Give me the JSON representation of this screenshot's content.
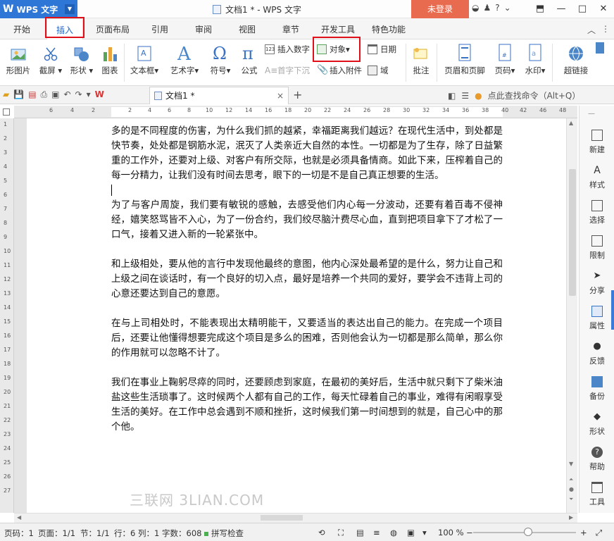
{
  "window": {
    "app_name": "WPS 文字",
    "title": "文档1 * - WPS 文字",
    "login_label": "未登录",
    "help_label": "?",
    "controls": [
      "—",
      "□",
      "✕"
    ]
  },
  "menu": {
    "tabs": [
      "开始",
      "插入",
      "页面布局",
      "引用",
      "审阅",
      "视图",
      "章节",
      "开发工具",
      "特色功能"
    ],
    "active": "插入"
  },
  "ribbon": {
    "big": [
      "形图片",
      "截屏",
      "形状",
      "图表",
      "文本框",
      "艺术字",
      "符号",
      "公式",
      "批注",
      "页眉和页脚",
      "页码",
      "水印",
      "超链接"
    ],
    "small": {
      "insert_number": "插入数字",
      "first_drop": "首字下沉",
      "object": "对象",
      "insert_attachment": "插入附件",
      "date": "日期",
      "field": "域"
    }
  },
  "doc_tab": {
    "name": "文档1 *",
    "search_hint": "点此查找命令（Alt+Q）"
  },
  "ruler": {
    "h_ticks": [
      "6",
      "4",
      "2",
      "2",
      "4",
      "6",
      "8",
      "10",
      "12",
      "14",
      "16",
      "18",
      "20",
      "22",
      "24",
      "26",
      "28",
      "30",
      "32",
      "34",
      "36",
      "38",
      "40",
      "42",
      "46",
      "48"
    ],
    "v_ticks": [
      "1",
      "2",
      "3",
      "4",
      "5",
      "6",
      "7",
      "8",
      "9",
      "10",
      "11",
      "12",
      "13",
      "14",
      "15",
      "16",
      "17",
      "18",
      "19",
      "20",
      "21",
      "22",
      "23",
      "24",
      "25",
      "26",
      "27"
    ]
  },
  "document": {
    "paragraphs": [
      "多的是不同程度的伤害，为什么我们抓的越紧，幸福距离我们越远？在现代生活中，到处都是快节奏，处处都是钢筋水泥，泯灭了人类亲近大自然的本性。一切都是为了生存，除了日益繁重的工作外，还要对上级、对客户有所交际，也就是必须具备情商。如此下来，压榨着自己的每一分精力，让我们没有时间去思考，眼下的一切是不是自己真正想要的生活。",
      "为了与客户周旋，我们要有敏锐的感触，去感受他们内心每一分波动，还要有着百毒不侵神经，嬉笑怒骂皆不入心，为了一份合约，我们绞尽脑汁费尽心血，直到把项目拿下了才松了一口气，接着又进入新的一轮紧张中。",
      "和上级相处，要从他的言行中发现他最终的意图，他内心深处最希望的是什么，努力让自己和上级之间在谈话时，有一个良好的切入点，最好是培养一个共同的爱好，要学会不违背上司的心意还要达到自己的意愿。",
      "在与上司相处时，不能表现出太精明能干，又要适当的表达出自己的能力。在完成一个项目后，还要让他懂得想要完成这个项目是多么的困难，否则他会认为一切都是那么简单，那么你的作用就可以忽略不计了。",
      "我们在事业上鞠躬尽瘁的同时，还要顾虑到家庭，在最初的美好后，生活中就只剩下了柴米油盐这些生活琐事了。这时候两个人都有自己的工作，每天忙碌着自己的事业，难得有闲暇享受生活的美好。在工作中总会遇到不顺和挫折，这时候我们第一时间想到的就是，自己心中的那个他。"
    ]
  },
  "side_panel": [
    "新建",
    "样式",
    "选择",
    "限制",
    "分享",
    "属性",
    "反馈",
    "备份",
    "形状",
    "帮助",
    "工具"
  ],
  "status": {
    "page_no": "页码：1",
    "pages": "页面：1/1",
    "section": "节：1/1",
    "row_col": "行：6  列：1",
    "word_count": "字数：608",
    "spell": "拼写检查",
    "zoom": "100 %",
    "zoom_level_percent": 100
  },
  "watermark": "三联网 3LIAN.COM",
  "colors": {
    "brand": "#2f77d6",
    "login": "#e96b4f",
    "highlight": "#e0101a"
  }
}
